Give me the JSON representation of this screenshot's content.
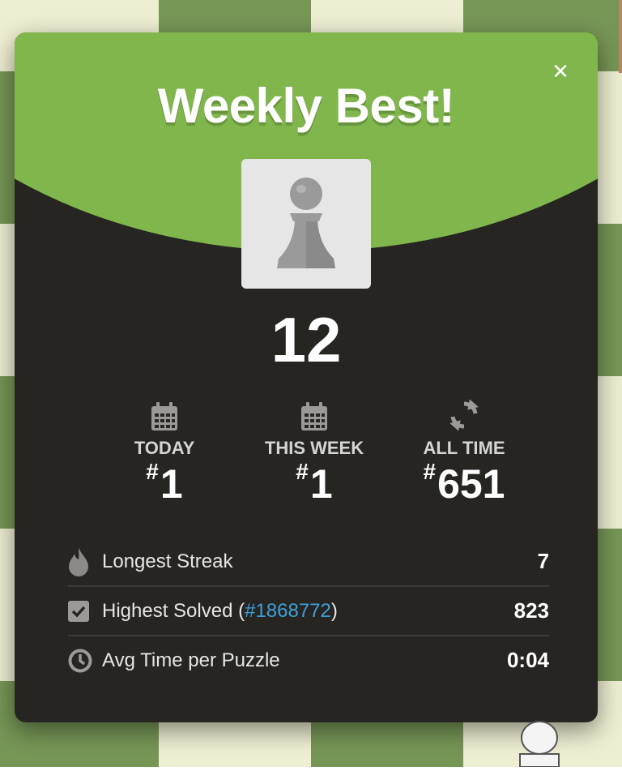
{
  "modal": {
    "title": "Weekly Best!",
    "close_label": "×",
    "score": "12",
    "icon": "pawn-icon"
  },
  "ranks": [
    {
      "label": "TODAY",
      "hash": "#",
      "value": "1",
      "icon": "calendar-icon"
    },
    {
      "label": "THIS WEEK",
      "hash": "#",
      "value": "1",
      "icon": "calendar-icon"
    },
    {
      "label": "ALL TIME",
      "hash": "#",
      "value": "651",
      "icon": "refresh-icon"
    }
  ],
  "stats": [
    {
      "label": "Longest Streak",
      "value": "7",
      "icon": "flame-icon"
    },
    {
      "label_prefix": "Highest Solved (",
      "link": "#1868772",
      "label_suffix": ")",
      "value": "823",
      "icon": "checkbox-icon"
    },
    {
      "label": "Avg Time per Puzzle",
      "value": "0:04",
      "icon": "clock-icon"
    }
  ],
  "colors": {
    "header_green": "#81b64c",
    "modal_bg": "#262522",
    "link_blue": "#3f9fd9",
    "board_light": "#eeeed2",
    "board_dark": "#769656"
  }
}
